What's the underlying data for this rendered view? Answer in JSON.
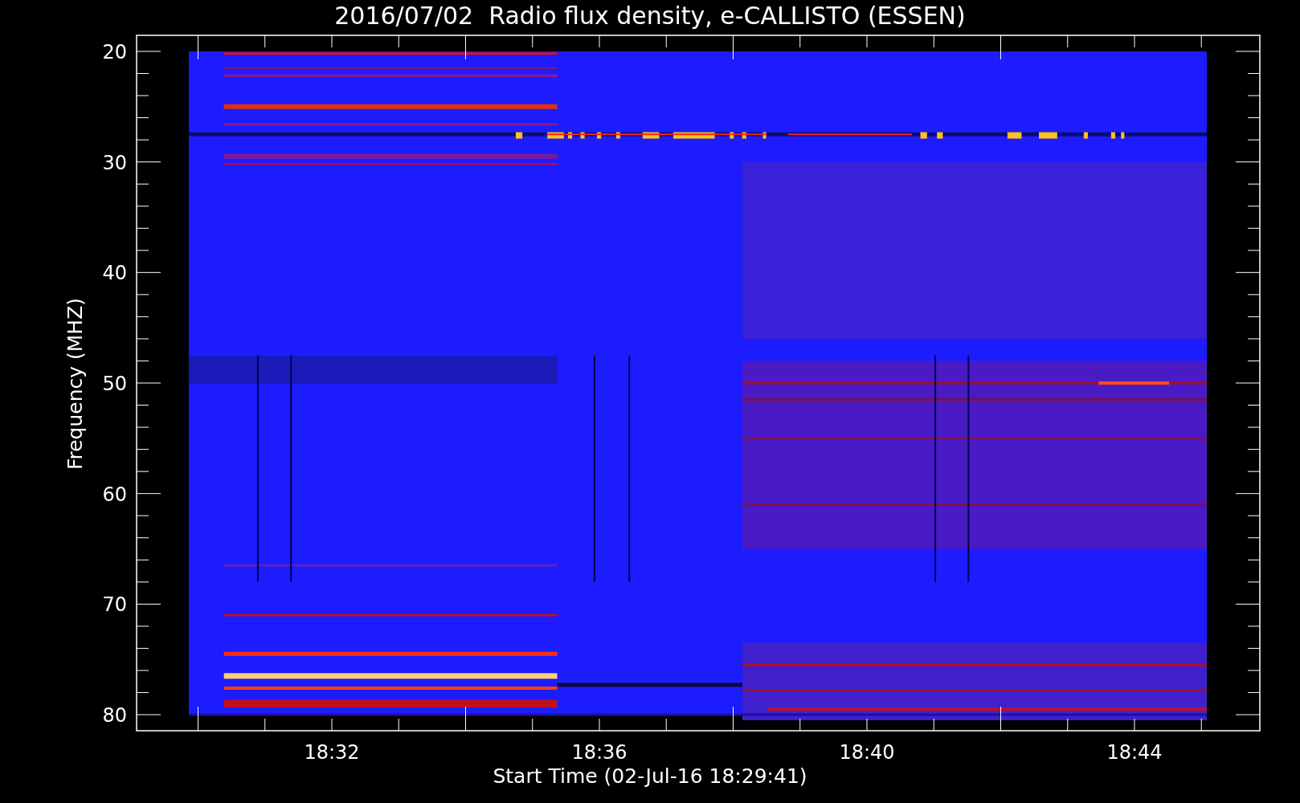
{
  "title": "2016/07/02  Radio flux density, e-CALLISTO (ESSEN)",
  "y_axis": {
    "label": "Frequency (MHZ)",
    "ticks": [
      "20",
      "30",
      "40",
      "50",
      "60",
      "70",
      "80"
    ]
  },
  "x_axis": {
    "label": "Start Time (02-Jul-16 18:29:41)",
    "ticks": [
      "18:32",
      "18:36",
      "18:40",
      "18:44"
    ]
  }
}
